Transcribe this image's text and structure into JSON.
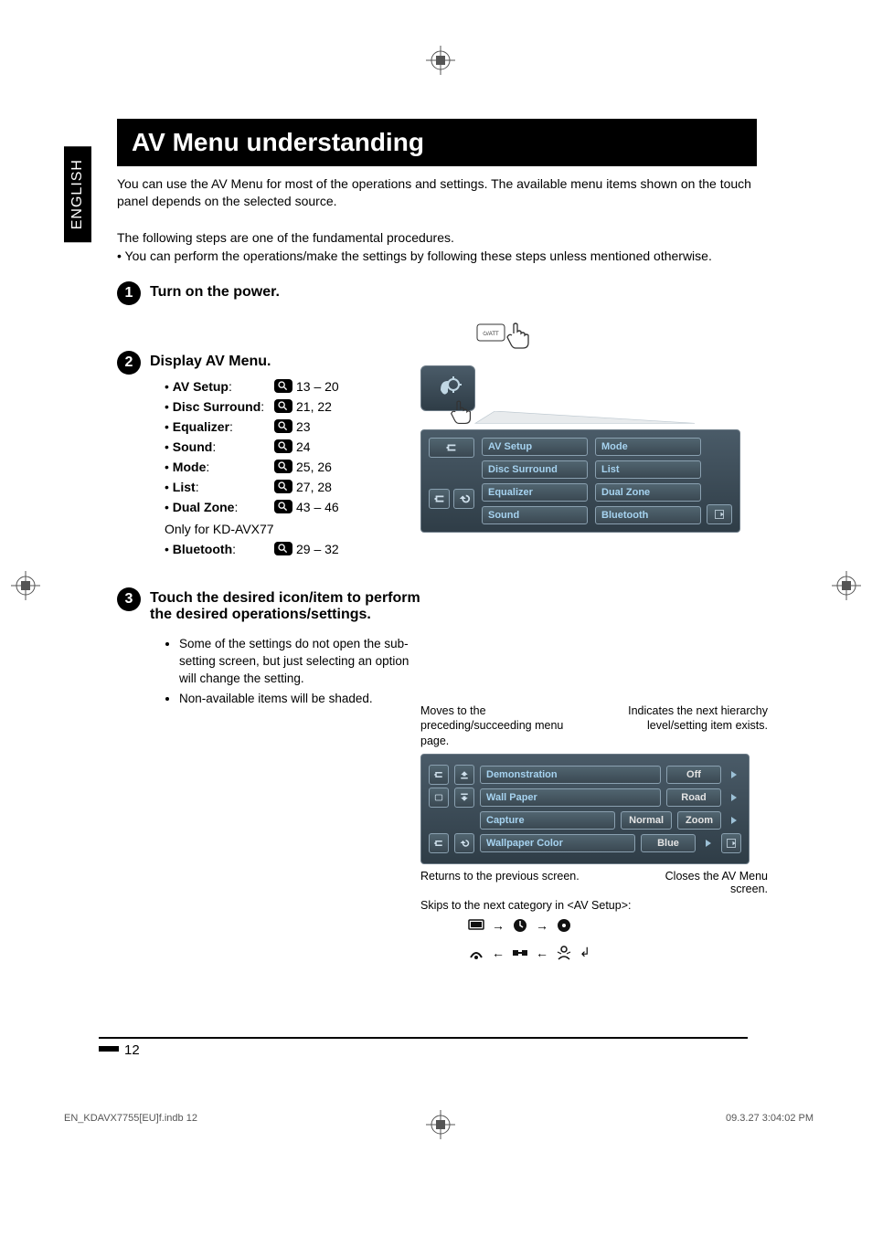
{
  "language_tab": "ENGLISH",
  "header_title": "AV Menu understanding",
  "intro_text": "You can use the AV Menu for most of the operations and settings. The available menu items shown on the touch panel depends on the selected source.",
  "sub_intro_text": "The following steps are one of the fundamental procedures.",
  "sub_intro_bullet": "You can perform the operations/make the settings by following these steps unless mentioned otherwise.",
  "steps": {
    "s1": {
      "title": "Turn on the power."
    },
    "s2": {
      "title": "Display AV Menu.",
      "items": [
        {
          "name": "AV Setup",
          "pages": "13 – 20"
        },
        {
          "name": "Disc Surround",
          "pages": "21, 22"
        },
        {
          "name": "Equalizer",
          "pages": "23"
        },
        {
          "name": "Sound",
          "pages": "24"
        },
        {
          "name": "Mode",
          "pages": "25, 26"
        },
        {
          "name": "List",
          "pages": "27, 28"
        },
        {
          "name": "Dual Zone",
          "pages": "43 – 46"
        }
      ],
      "only_note": "Only for KD-AVX77",
      "bluetooth": {
        "name": "Bluetooth",
        "pages": "29 – 32"
      }
    },
    "s3": {
      "title": "Touch the desired icon/item to perform the desired operations/settings.",
      "note1": "Some of the settings do not open the sub-setting screen, but just selecting an option will change the setting.",
      "note2": "Non-available items will be shaded."
    }
  },
  "menu_chips": {
    "left": [
      "AV Setup",
      "Disc Surround",
      "Equalizer",
      "Sound"
    ],
    "right": [
      "Mode",
      "List",
      "Dual Zone",
      "Bluetooth"
    ]
  },
  "detail_panel": {
    "caption_left": "Moves to the preceding/succeeding menu page.",
    "caption_right": "Indicates the next hierarchy level/setting item exists.",
    "rows": [
      {
        "label": "Demonstration",
        "values": [
          "Off"
        ]
      },
      {
        "label": "Wall Paper",
        "values": [
          "Road"
        ]
      },
      {
        "label": "Capture",
        "values": [
          "Normal",
          "Zoom"
        ]
      },
      {
        "label": "Wallpaper Color",
        "values": [
          "Blue"
        ]
      }
    ],
    "below_left": "Returns to the previous screen.",
    "below_right_a": "Closes the AV Menu",
    "below_right_b": "screen.",
    "skip_line": "Skips to the next category in <AV Setup>:"
  },
  "page_number": "12",
  "footer_left": "EN_KDAVX7755[EU]f.indb   12",
  "footer_right": "09.3.27   3:04:02 PM"
}
